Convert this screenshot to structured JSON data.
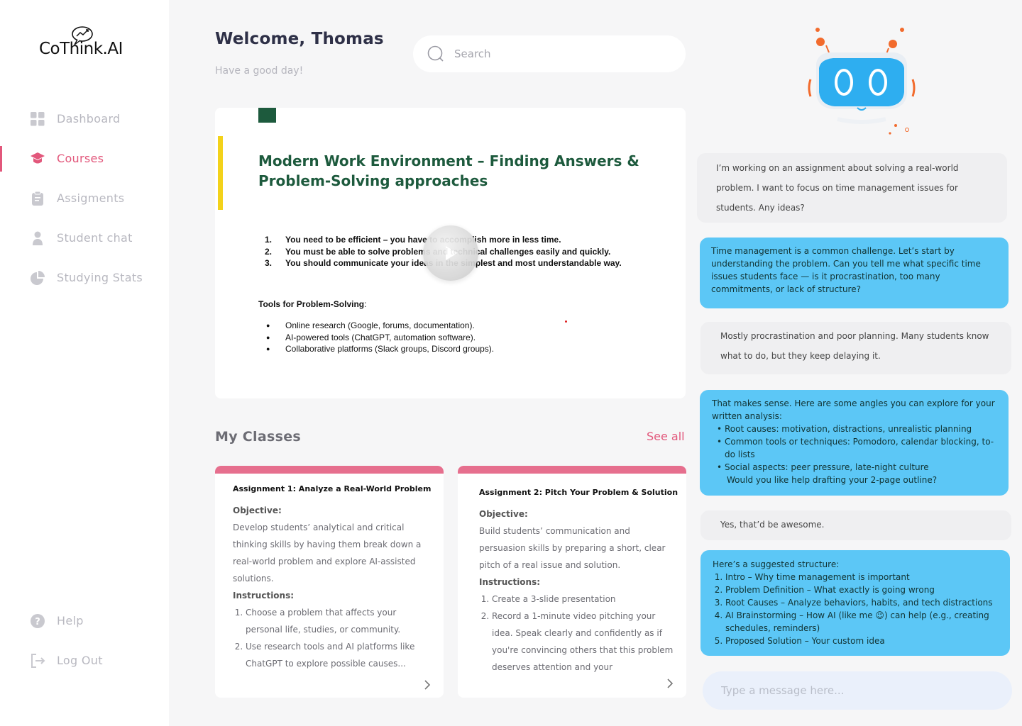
{
  "app": {
    "logo_text": "CoThink.AI"
  },
  "sidebar": {
    "items": [
      {
        "label": "Dashboard",
        "icon": "grid-icon",
        "active": false
      },
      {
        "label": "Courses",
        "icon": "graduation-cap-icon",
        "active": true
      },
      {
        "label": "Assigments",
        "icon": "clipboard-icon",
        "active": false
      },
      {
        "label": "Student chat",
        "icon": "person-icon",
        "active": false
      },
      {
        "label": "Studying Stats",
        "icon": "pie-chart-icon",
        "active": false
      }
    ],
    "bottom": [
      {
        "label": "Help",
        "icon": "help-icon"
      },
      {
        "label": "Log Out",
        "icon": "logout-icon"
      }
    ]
  },
  "header": {
    "welcome": "Welcome, Thomas",
    "subtitle": "Have a good day!",
    "search_placeholder": "Search"
  },
  "video": {
    "slide_title": "Modern Work Environment – Finding Answers & Problem-Solving approaches",
    "points": [
      {
        "num": "1.",
        "text": "You need to be efficient – you have to accomplish more in less time."
      },
      {
        "num": "2.",
        "text": "You must be able to solve problems and technical challenges easily and quickly."
      },
      {
        "num": "3.",
        "text": "You should communicate your ideas in the simplest and most understandable way."
      }
    ],
    "tools_heading": "Tools for Problem-Solving",
    "tools_colon": ":",
    "tools": [
      "Online research (Google, forums, documentation).",
      "AI-powered tools (ChatGPT, automation software).",
      "Collaborative platforms (Slack groups, Discord groups)."
    ]
  },
  "classes": {
    "title": "My Classes",
    "see_all": "See all",
    "cards": [
      {
        "title": "Assignment 1: Analyze a Real-World Problem",
        "objective_label": "Objective:",
        "objective": "Develop students’ analytical and critical thinking skills by having them break down a real-world problem and explore AI-assisted solutions.",
        "instructions_label": "Instructions:",
        "steps": [
          "Choose a problem that affects your personal life, studies, or community.",
          "Use research tools and AI platforms like ChatGPT to explore possible causes..."
        ]
      },
      {
        "title": "Assignment 2: Pitch Your Problem & Solution",
        "objective_label": "Objective:",
        "objective": "Build students’ communication and persuasion skills by preparing a short, clear pitch of a real issue and solution.",
        "instructions_label": "Instructions:",
        "steps": [
          "Create a 3-slide presentation",
          "Record a 1-minute video pitching your idea. Speak clearly and confidently as if you're convincing others that this problem deserves attention and your"
        ]
      }
    ]
  },
  "chat": {
    "messages": [
      {
        "role": "user",
        "text": "I’m working on an assignment about solving a real-world problem. I want to focus on time management issues for students. Any ideas?"
      },
      {
        "role": "bot",
        "text": "Time management is a common challenge. Let’s start by understanding the problem. Can you tell me what specific time issues students face — is it procrastination, too many commitments, or lack of structure?"
      },
      {
        "role": "user",
        "text": "Mostly procrastination and poor planning. Many students know what to do, but they keep delaying it."
      },
      {
        "role": "bot",
        "intro": "That makes sense. Here are some angles you can explore for your written analysis:",
        "bullets": [
          "Root causes: motivation, distractions, unrealistic planning",
          "Common tools or techniques: Pomodoro, calendar blocking, to-do lists",
          "Social aspects: peer pressure, late-night culture"
        ],
        "outro": "Would you like help drafting your 2-page outline?"
      },
      {
        "role": "user",
        "text": "Yes, that’d be awesome."
      },
      {
        "role": "bot",
        "intro": "Here’s a suggested structure:",
        "steps": [
          "Intro – Why time management is important",
          "Problem Definition – What exactly is going wrong",
          "Root Causes – Analyze behaviors, habits, and tech distractions",
          "AI Brainstorming – How AI (like me 😉) can help (e.g., creating schedules, reminders)",
          "Proposed Solution – Your custom idea"
        ]
      }
    ],
    "input_placeholder": "Type a message here..."
  },
  "colors": {
    "accent": "#e2577b",
    "bot_bubble": "#5cc7f6",
    "user_bubble": "#efeff1",
    "slide_green": "#1d5a3d",
    "slide_yellow": "#f3d21a",
    "card_bar": "#e66f8e"
  }
}
